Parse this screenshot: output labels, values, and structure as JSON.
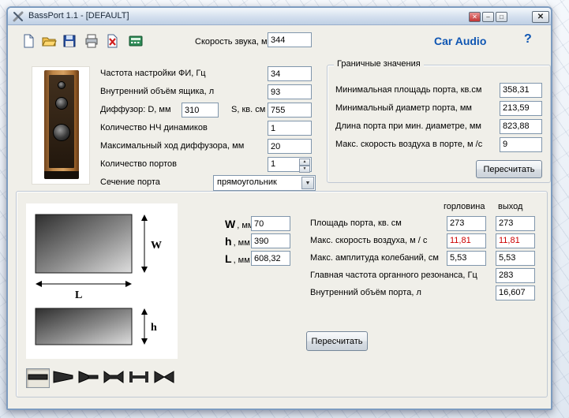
{
  "colors": {
    "accent_blue": "#0f56b3",
    "alert_red": "#cc0000"
  },
  "window": {
    "title": "BassPort 1.1 - [DEFAULT]"
  },
  "icons": {
    "minimize": "–",
    "maximize": "□",
    "close": "✕",
    "child_close": "✕",
    "spinner_up": "▲",
    "spinner_down": "▼",
    "dropdown_arrow": "▼"
  },
  "toolbar": {
    "icon_names": [
      "new-file-icon",
      "open-file-icon",
      "save-icon",
      "print-icon",
      "delete-icon",
      "calculator-icon"
    ],
    "speed_label": "Скорость звука, м /с",
    "speed_value": "344",
    "brand": "Car Audio",
    "help_label": "?"
  },
  "params": {
    "rows": [
      {
        "label": "Частота настройки ФИ, Гц",
        "value": "34"
      },
      {
        "label": "Внутренний объём ящика, л",
        "value": "93"
      },
      {
        "label": "Диффузор: D, мм",
        "value": "310",
        "label2": "S, кв. см",
        "value2": "755"
      },
      {
        "label": "Количество НЧ динамиков",
        "value": "1"
      },
      {
        "label": "Максимальный ход диффузора, мм",
        "value": "20"
      },
      {
        "label": "Количество портов",
        "value": "1"
      },
      {
        "label": "Сечение порта",
        "value": "прямоугольник"
      }
    ]
  },
  "limits": {
    "title": "Граничные значения",
    "rows": [
      {
        "label": "Минимальная площадь порта, кв.см",
        "value": "358,31"
      },
      {
        "label": "Минимальный диаметр порта, мм",
        "value": "213,59"
      },
      {
        "label": "Длина порта при мин. диаметре, мм",
        "value": "823,88"
      },
      {
        "label": "Макс. скорость воздуха в порте, м /с",
        "value": "9"
      }
    ],
    "recalc_label": "Пересчитать"
  },
  "port": {
    "dims": [
      {
        "letter": "W",
        "unit": ", мм",
        "value": "70"
      },
      {
        "letter": "h",
        "unit": ", мм",
        "value": "390"
      },
      {
        "letter": "L",
        "unit": ", мм",
        "value": "608,32"
      }
    ],
    "col_headers": [
      "горловина",
      "выход"
    ],
    "rows": [
      {
        "label": "Площадь порта, кв. см",
        "v1": "273",
        "v2": "273"
      },
      {
        "label": "Макс. скорость воздуха, м / с",
        "v1": "11,81",
        "v2": "11,81"
      },
      {
        "label": "Макс. амплитуда колебаний, см",
        "v1": "5,53",
        "v2": "5,53"
      },
      {
        "label": "Главная частота органного резонанса, Гц",
        "v2": "283"
      },
      {
        "label": "Внутренний объём порта, л",
        "v2": "16,607"
      }
    ],
    "recalc_label": "Пересчитать",
    "diagram_labels": {
      "w": "W",
      "l": "L",
      "h": "h"
    },
    "profile_icons": [
      "straight-port-icon",
      "conical-port-icon",
      "horn-port-icon",
      "double-flared-port-icon",
      "flanged-port-icon",
      "double-horn-port-icon"
    ]
  }
}
